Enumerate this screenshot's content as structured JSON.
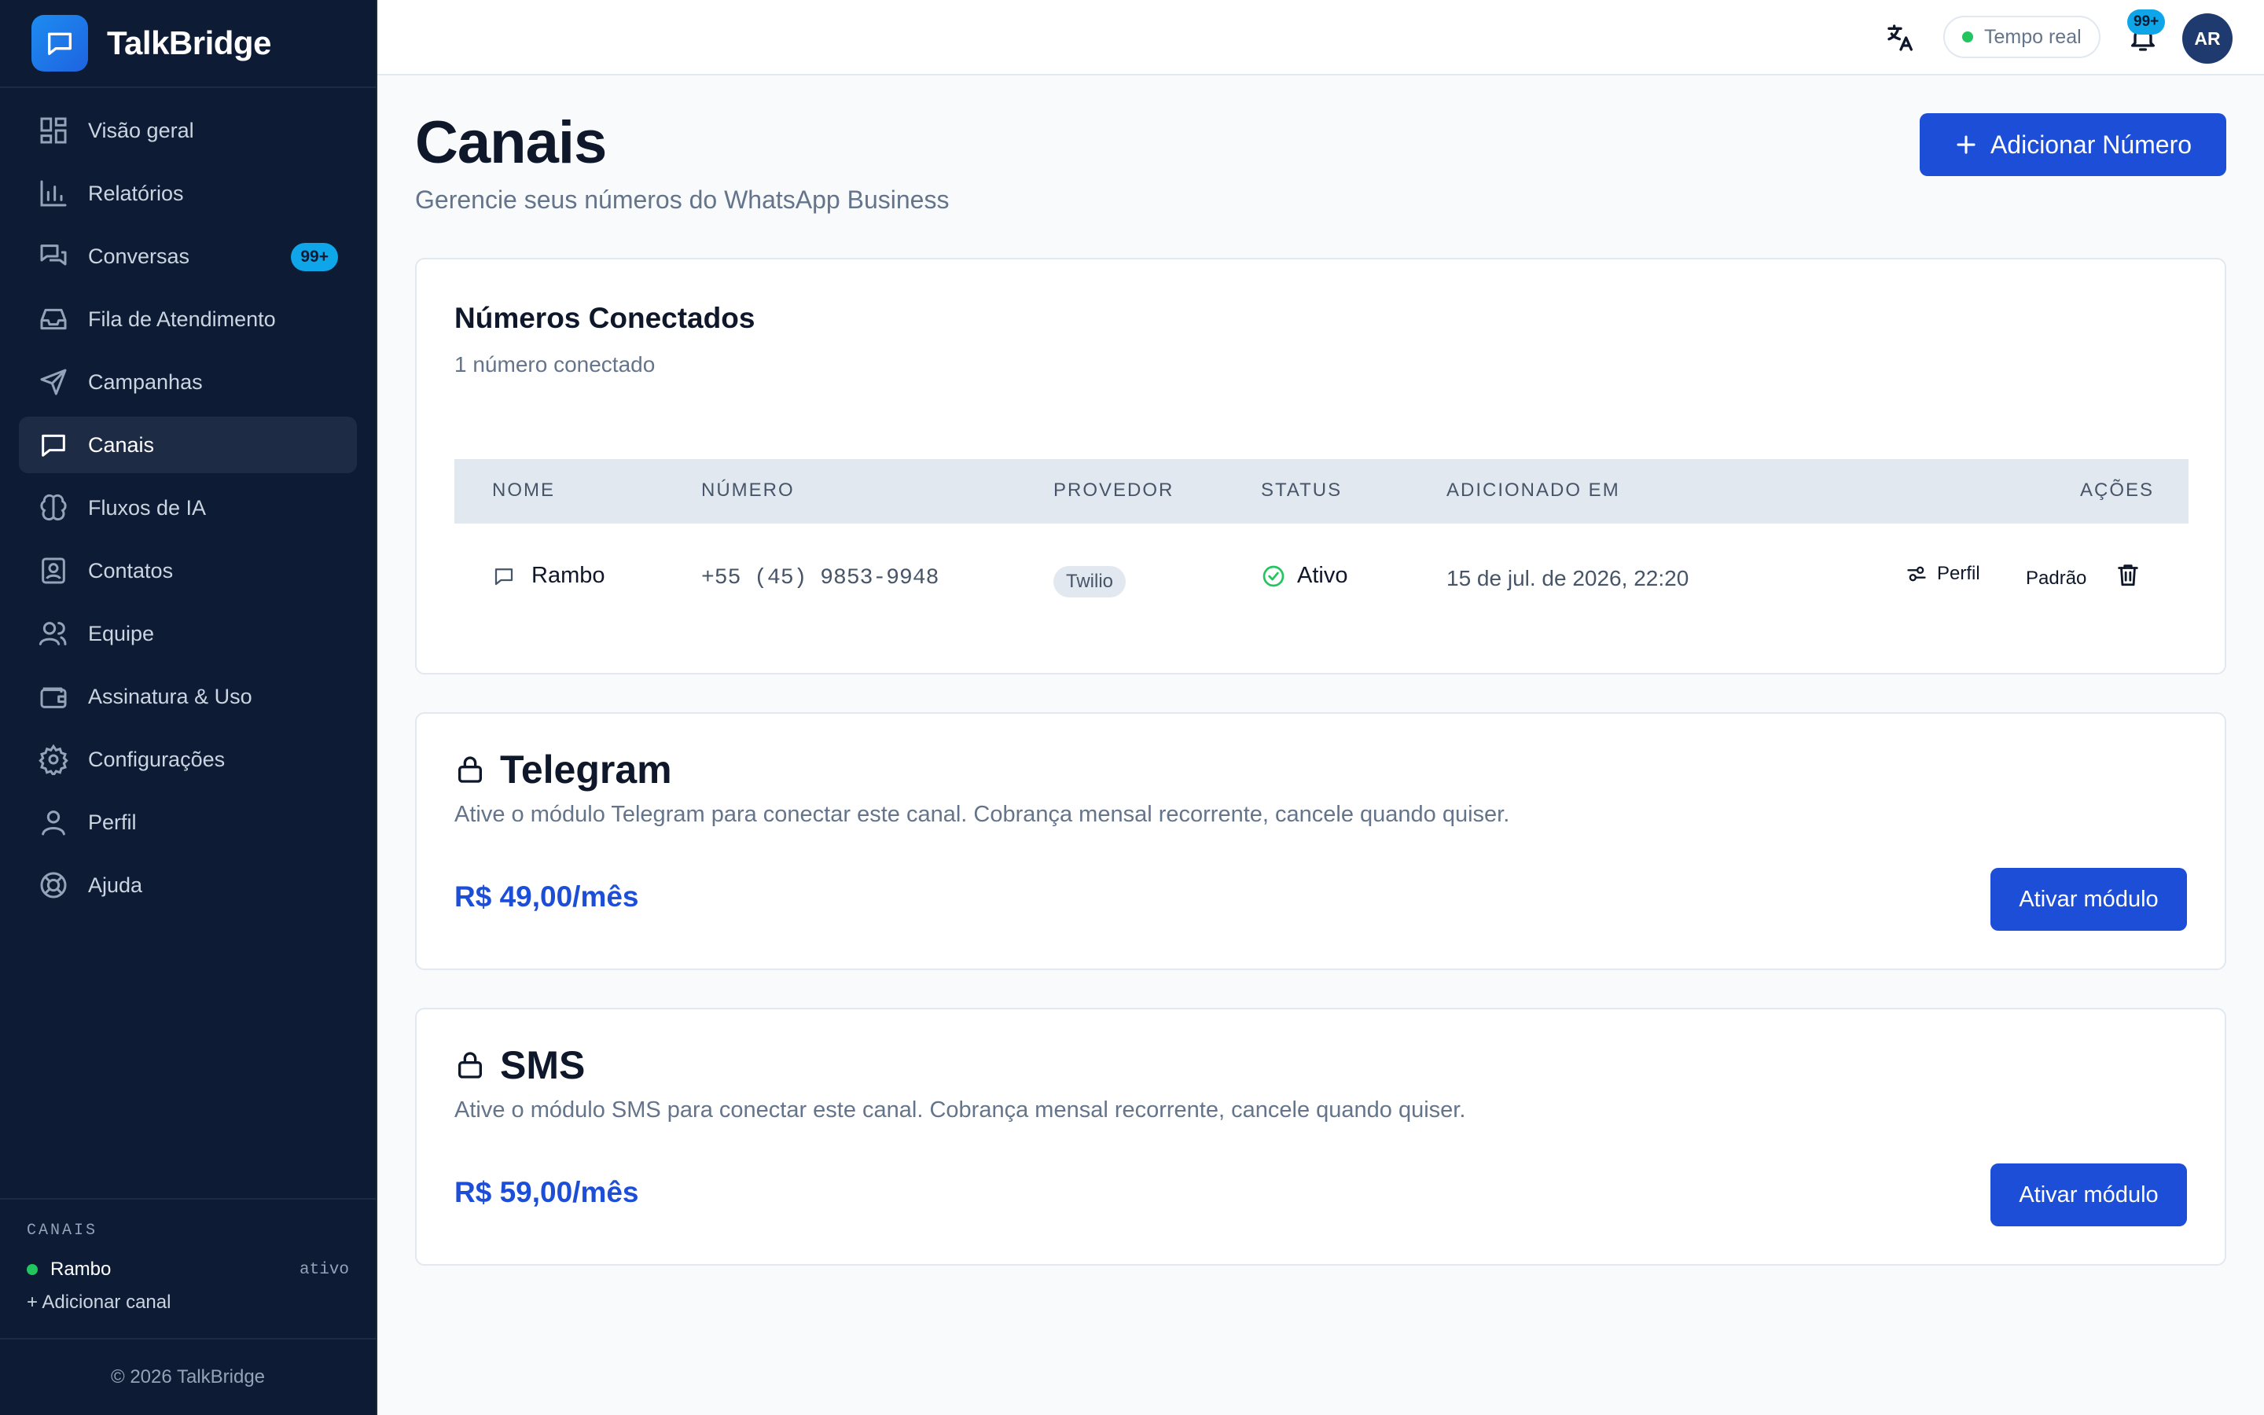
{
  "app": {
    "name": "TalkBridge",
    "logo_icon": "chat-bubble-icon"
  },
  "sidebar": {
    "items": [
      {
        "label": "Visão geral",
        "icon": "dashboard-icon"
      },
      {
        "label": "Relatórios",
        "icon": "bar-chart-icon"
      },
      {
        "label": "Conversas",
        "icon": "chat-bubbles-icon",
        "badge": "99+"
      },
      {
        "label": "Fila de Atendimento",
        "icon": "inbox-icon"
      },
      {
        "label": "Campanhas",
        "icon": "send-icon"
      },
      {
        "label": "Canais",
        "icon": "chat-bubble-icon",
        "active": true
      },
      {
        "label": "Fluxos de IA",
        "icon": "brain-icon"
      },
      {
        "label": "Contatos",
        "icon": "contact-card-icon"
      },
      {
        "label": "Equipe",
        "icon": "users-icon"
      },
      {
        "label": "Assinatura & Uso",
        "icon": "wallet-icon"
      },
      {
        "label": "Configurações",
        "icon": "gear-icon"
      },
      {
        "label": "Perfil",
        "icon": "user-icon"
      },
      {
        "label": "Ajuda",
        "icon": "lifebuoy-icon"
      }
    ],
    "channels": {
      "title": "CANAIS",
      "list": [
        {
          "name": "Rambo",
          "status": "ativo"
        }
      ],
      "add_label": "+ Adicionar canal"
    },
    "footer": "© 2026 TalkBridge"
  },
  "topbar": {
    "realtime_label": "Tempo real",
    "notifications_badge": "99+",
    "avatar_initials": "AR"
  },
  "page": {
    "title": "Canais",
    "subtitle": "Gerencie seus números do WhatsApp Business",
    "add_button": "Adicionar Número"
  },
  "numbers_card": {
    "title": "Números Conectados",
    "subtitle": "1 número conectado",
    "columns": [
      "NOME",
      "NÚMERO",
      "PROVEDOR",
      "STATUS",
      "ADICIONADO EM",
      "AÇÕES"
    ],
    "rows": [
      {
        "name": "Rambo",
        "number": "+55 (45) 9853-9948",
        "provider": "Twilio",
        "status": "Ativo",
        "added": "15 de jul. de 2026, 22:20",
        "action_profile": "Perfil",
        "action_default": "Padrão"
      }
    ]
  },
  "modules": [
    {
      "title": "Telegram",
      "description": "Ative o módulo Telegram para conectar este canal. Cobrança mensal recorrente, cancele quando quiser.",
      "price": "R$ 49,00/mês",
      "button": "Ativar módulo"
    },
    {
      "title": "SMS",
      "description": "Ative o módulo SMS para conectar este canal. Cobrança mensal recorrente, cancele quando quiser.",
      "price": "R$ 59,00/mês",
      "button": "Ativar módulo"
    }
  ],
  "colors": {
    "sidebar_bg": "#0d1b34",
    "primary": "#1d4ed8",
    "badge": "#0ea5e9",
    "success": "#22c55e"
  }
}
